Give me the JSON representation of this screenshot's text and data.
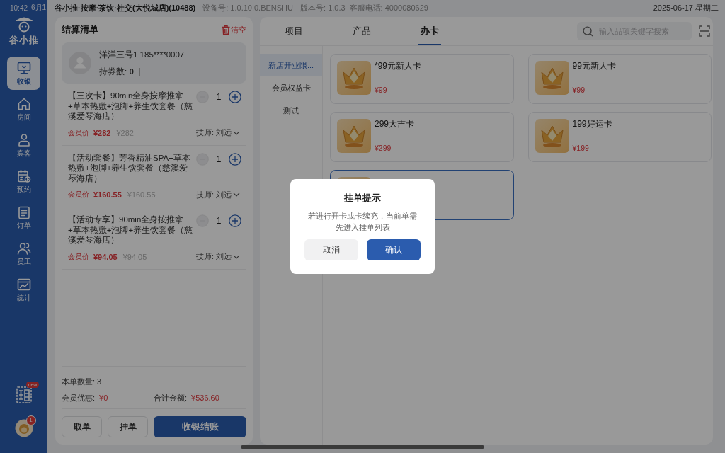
{
  "status_bar": {
    "time": "10:42",
    "date": "6月1"
  },
  "header": {
    "store": "谷小推·按摩·茶饮·社交(大悦城店)(10488)",
    "device": "设备号: 1.0.10.0.BENSHU",
    "version": "版本号: 1.0.3",
    "hotline": "客服电话: 4000080629",
    "datetime": "2025-06-17 星期二"
  },
  "sidebar": {
    "logo": "谷小推",
    "items": [
      {
        "label": "收银",
        "selected": true
      },
      {
        "label": "房间",
        "selected": false
      },
      {
        "label": "宾客",
        "selected": false
      },
      {
        "label": "预约",
        "selected": false
      },
      {
        "label": "订单",
        "selected": false
      },
      {
        "label": "员工",
        "selected": false
      },
      {
        "label": "统计",
        "selected": false
      }
    ],
    "promo_badge": "new",
    "notification_count": "1"
  },
  "checkout": {
    "title": "结算清单",
    "clear": "清空",
    "member": {
      "name": "洋洋三号1 185****0007",
      "coupons": "持券数: **0**"
    },
    "items": [
      {
        "title": "【三次卡】90min全身按摩推拿+草本热敷+泡脚+养生饮套餐（慈溪爱琴海店）",
        "decrease_disabled": true,
        "quantity": "1",
        "member_price_label": "会员价",
        "member_price": "¥282",
        "price": "¥282",
        "therapist": "技师: 刘远"
      },
      {
        "title": "【活动套餐】芳香精油SPA+草本热敷+泡脚+养生饮套餐（慈溪爱琴海店）",
        "decrease_disabled": true,
        "quantity": "1",
        "member_price_label": "会员价",
        "member_price": "¥160.55",
        "price": "¥160.55",
        "therapist": "技师: 刘远"
      },
      {
        "title": "【活动专享】90min全身按推拿+草本热敷+泡脚+养生饮套餐（慈溪爱琴海店）",
        "decrease_disabled": true,
        "quantity": "1",
        "member_price_label": "会员价",
        "member_price": "¥94.05",
        "price": "¥94.05",
        "therapist": "技师: 刘远"
      }
    ],
    "summary": {
      "count": "本单数量: 3",
      "discount_label": "会员优惠:",
      "discount": "¥0",
      "total_label": "合计金额:",
      "total": "¥536.60"
    },
    "buttons": [
      {
        "label": "取单",
        "kind": "secondary"
      },
      {
        "label": "挂单",
        "kind": "secondary"
      },
      {
        "label": "收银结账",
        "kind": "primary"
      }
    ]
  },
  "catalog": {
    "tabs": [
      {
        "label": "项目",
        "selected": false
      },
      {
        "label": "产品",
        "selected": false
      },
      {
        "label": "办卡",
        "selected": true
      }
    ],
    "search": {
      "placeholder": "输入品项关键字搜索"
    },
    "categories": [
      {
        "label": "新店开业限...",
        "selected": true
      },
      {
        "label": "会员权益卡",
        "selected": false
      },
      {
        "label": "测试",
        "selected": false
      }
    ],
    "cards": [
      {
        "name": "*99元新人卡",
        "price": "¥99",
        "selected": false
      },
      {
        "name": "99元新人卡",
        "price": "¥99",
        "selected": false
      },
      {
        "name": "299大吉卡",
        "price": "¥299",
        "selected": false
      },
      {
        "name": "199好运卡",
        "price": "¥199",
        "selected": false
      },
      {
        "selected": true
      }
    ]
  },
  "dialog": {
    "title": "挂单提示",
    "message": "若进行开卡或卡续充，当前单需先进入挂单列表",
    "buttons": [
      {
        "label": "取消",
        "kind": "secondary"
      },
      {
        "label": "确认",
        "kind": "primary"
      }
    ]
  }
}
